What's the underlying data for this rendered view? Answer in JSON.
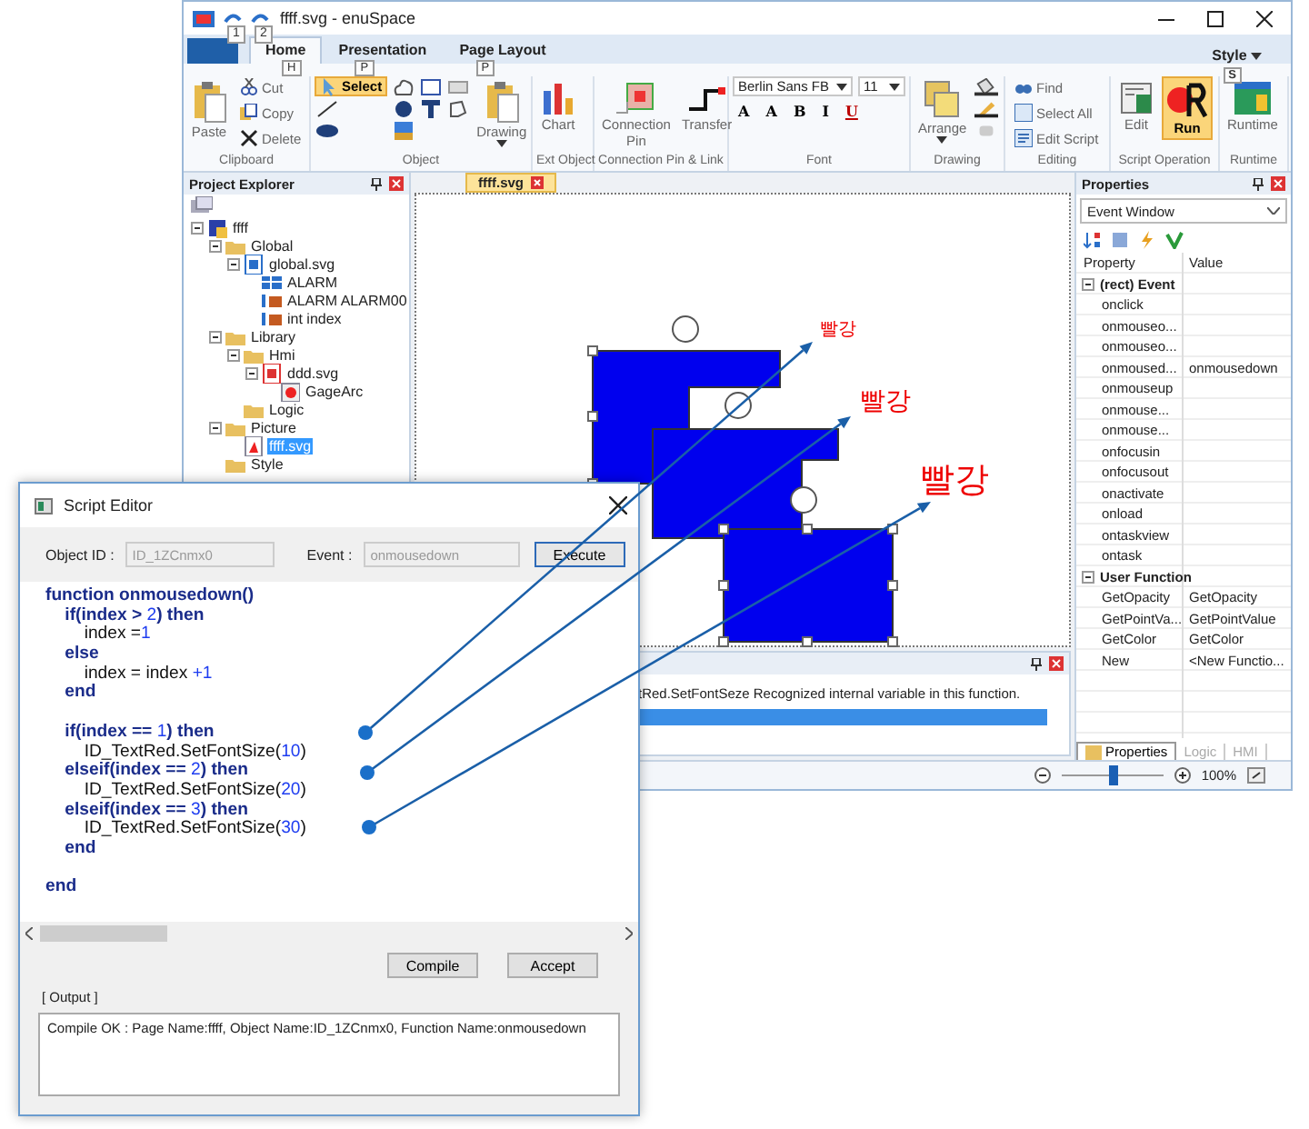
{
  "app_window": {
    "title": "ffff.svg - enuSpace",
    "quick_access_keys": [
      "1",
      "2"
    ],
    "ribbon_tabs": [
      {
        "label": "Home",
        "key": "H",
        "selected": true
      },
      {
        "label": "Presentation",
        "key": "P",
        "selected": false
      },
      {
        "label": "Page Layout",
        "key": "P",
        "selected": false
      }
    ],
    "style_menu": {
      "label": "Style",
      "key": "S"
    },
    "ribbon_groups": [
      {
        "label": "Clipboard",
        "items": [
          {
            "kind": "large",
            "label": "Paste",
            "selected": false
          },
          {
            "kind": "small",
            "label": "Cut",
            "selected": false
          },
          {
            "kind": "small",
            "label": "Copy",
            "selected": false
          },
          {
            "kind": "small",
            "label": "Delete",
            "selected": false
          }
        ]
      },
      {
        "label": "Object",
        "items": [
          {
            "kind": "small",
            "label": "Select",
            "selected": true
          },
          {
            "kind": "tool",
            "selected": false
          },
          {
            "kind": "tool",
            "selected": false
          },
          {
            "kind": "tool",
            "selected": false
          },
          {
            "kind": "tool",
            "selected": false
          },
          {
            "kind": "tool",
            "selected": false
          },
          {
            "kind": "tool",
            "selected": false
          },
          {
            "kind": "tool",
            "selected": false
          },
          {
            "kind": "tool",
            "selected": false
          },
          {
            "kind": "tool",
            "selected": false
          },
          {
            "kind": "large",
            "label": "Drawing",
            "dropdown": true,
            "selected": false
          }
        ]
      },
      {
        "label": "Ext Object",
        "items": [
          {
            "kind": "large",
            "label": "Chart",
            "selected": false
          }
        ]
      },
      {
        "label": "Connection Pin & Link",
        "items": [
          {
            "kind": "large",
            "label": "Connection Pin",
            "selected": false
          },
          {
            "kind": "large",
            "label": "Transfer",
            "selected": false
          }
        ]
      },
      {
        "label": "Font",
        "items": [
          {
            "kind": "combo",
            "value": "Berlin Sans FB"
          },
          {
            "kind": "combo",
            "value": "11"
          },
          {
            "kind": "format",
            "label": "A"
          },
          {
            "kind": "format",
            "label": "A"
          },
          {
            "kind": "format",
            "label": "B"
          },
          {
            "kind": "format",
            "label": "I"
          },
          {
            "kind": "format",
            "label": "U"
          }
        ]
      },
      {
        "label": "Drawing",
        "items": [
          {
            "kind": "large",
            "label": "Arrange",
            "dropdown": true,
            "selected": false
          },
          {
            "kind": "tool",
            "selected": false
          },
          {
            "kind": "tool",
            "selected": false
          },
          {
            "kind": "tool",
            "selected": false
          }
        ]
      },
      {
        "label": "Editing",
        "items": [
          {
            "kind": "small",
            "label": "Find",
            "selected": false
          },
          {
            "kind": "small",
            "label": "Select All",
            "selected": false
          },
          {
            "kind": "small",
            "label": "Edit Script",
            "selected": false
          }
        ]
      },
      {
        "label": "Script Operation",
        "items": [
          {
            "kind": "large",
            "label": "Edit",
            "selected": false
          },
          {
            "kind": "large",
            "label": "Run",
            "selected": true
          }
        ]
      },
      {
        "label": "Runtime",
        "items": [
          {
            "kind": "large",
            "label": "Runtime",
            "selected": false
          }
        ]
      }
    ],
    "project_explorer": {
      "title": "Project Explorer",
      "tree": [
        {
          "label": "ffff",
          "kind": "project",
          "expanded": true,
          "selected": false,
          "children": [
            {
              "label": "Global",
              "kind": "folder",
              "expanded": true,
              "selected": false,
              "children": [
                {
                  "label": "global.svg",
                  "kind": "global",
                  "expanded": true,
                  "selected": false,
                  "children": [
                    {
                      "label": "ALARM",
                      "kind": "table",
                      "selected": false
                    },
                    {
                      "label": "ALARM ALARM00",
                      "kind": "variable",
                      "selected": false
                    },
                    {
                      "label": "int index",
                      "kind": "variable",
                      "selected": false
                    }
                  ]
                }
              ]
            },
            {
              "label": "Library",
              "kind": "folder",
              "expanded": true,
              "selected": false,
              "children": [
                {
                  "label": "Hmi",
                  "kind": "folder",
                  "expanded": true,
                  "selected": false,
                  "children": [
                    {
                      "label": "ddd.svg",
                      "kind": "hmi",
                      "expanded": true,
                      "selected": false,
                      "children": [
                        {
                          "label": "GageArc",
                          "kind": "symbol",
                          "selected": false
                        }
                      ]
                    }
                  ]
                },
                {
                  "label": "Logic",
                  "kind": "folder",
                  "selected": false
                }
              ]
            },
            {
              "label": "Picture",
              "kind": "folder",
              "expanded": true,
              "selected": false,
              "children": [
                {
                  "label": "ffff.svg",
                  "kind": "page",
                  "selected": true
                }
              ]
            },
            {
              "label": "Style",
              "kind": "folder",
              "selected": false
            }
          ]
        }
      ]
    },
    "document_tabs": [
      {
        "label": "ffff.svg",
        "selected": true
      }
    ],
    "canvas": {
      "labels": [
        "빨강",
        "빨강",
        "빨강"
      ]
    },
    "output_panel": {
      "message": "tRed.SetFontSeze Recognized internal variable in this function."
    },
    "properties": {
      "title": "Properties",
      "selector": "Event Window",
      "columns": [
        "Property",
        "Value"
      ],
      "sections": [
        {
          "title": "(rect) Event",
          "expanded": true,
          "rows": [
            {
              "name": "onclick"
            },
            {
              "name": "onmouseo..."
            },
            {
              "name": "onmouseo..."
            },
            {
              "name": "onmoused...",
              "value": "onmousedown"
            },
            {
              "name": "onmouseup"
            },
            {
              "name": "onmouse..."
            },
            {
              "name": "onmouse..."
            },
            {
              "name": "onfocusin"
            },
            {
              "name": "onfocusout"
            },
            {
              "name": "onactivate"
            },
            {
              "name": "onload"
            },
            {
              "name": "ontaskview"
            },
            {
              "name": "ontask"
            }
          ]
        },
        {
          "title": "User Function",
          "expanded": true,
          "rows": [
            {
              "name": "GetOpacity",
              "value": "GetOpacity"
            },
            {
              "name": "GetPointVa...",
              "value": "GetPointValue"
            },
            {
              "name": "GetColor",
              "value": "GetColor"
            },
            {
              "name": "New",
              "value": "<New Functio..."
            }
          ]
        }
      ],
      "tabs": [
        {
          "label": "Properties",
          "selected": true
        },
        {
          "label": "Logic",
          "selected": false
        },
        {
          "label": "HMI",
          "selected": false
        }
      ]
    },
    "status_bar": {
      "zoom": "100%",
      "zoom_level": {
        "level": 0.5
      }
    }
  },
  "script_editor": {
    "title": "Script Editor",
    "object_id_label": "Object ID :",
    "object_id": "ID_1ZCnmx0",
    "event_label": "Event :",
    "event": "onmousedown",
    "execute_button": "Execute",
    "code_lines": [
      {
        "kind": "code",
        "tokens": [
          {
            "kind": "keyword",
            "text": "function onmousedown()"
          }
        ]
      },
      {
        "kind": "code",
        "tokens": [
          {
            "kind": "keyword",
            "text": "\tif(index > "
          },
          {
            "kind": "number",
            "text": "2"
          },
          {
            "kind": "keyword",
            "text": ") then"
          }
        ]
      },
      {
        "kind": "code",
        "tokens": [
          {
            "kind": "plain",
            "text": "\t\tindex ="
          },
          {
            "kind": "number",
            "text": "1"
          }
        ]
      },
      {
        "kind": "code",
        "tokens": [
          {
            "kind": "keyword",
            "text": "\telse"
          }
        ]
      },
      {
        "kind": "code",
        "tokens": [
          {
            "kind": "plain",
            "text": "\t\tindex = index "
          },
          {
            "kind": "number",
            "text": "+1"
          }
        ]
      },
      {
        "kind": "code",
        "tokens": [
          {
            "kind": "keyword",
            "text": "\tend"
          }
        ]
      },
      {
        "kind": "blank"
      },
      {
        "kind": "code",
        "tokens": [
          {
            "kind": "keyword",
            "text": "\tif(index == "
          },
          {
            "kind": "number",
            "text": "1"
          },
          {
            "kind": "keyword",
            "text": ") then"
          }
        ]
      },
      {
        "kind": "code",
        "tokens": [
          {
            "kind": "plain",
            "text": "\t\tID_TextRed.SetFontSize("
          },
          {
            "kind": "number",
            "text": "10"
          },
          {
            "kind": "plain",
            "text": ")"
          }
        ]
      },
      {
        "kind": "code",
        "tokens": [
          {
            "kind": "keyword",
            "text": "\telseif(index == "
          },
          {
            "kind": "number",
            "text": "2"
          },
          {
            "kind": "keyword",
            "text": ") then"
          }
        ]
      },
      {
        "kind": "code",
        "tokens": [
          {
            "kind": "plain",
            "text": "\t\tID_TextRed.SetFontSize("
          },
          {
            "kind": "number",
            "text": "20"
          },
          {
            "kind": "plain",
            "text": ")"
          }
        ]
      },
      {
        "kind": "code",
        "tokens": [
          {
            "kind": "keyword",
            "text": "\telseif(index == "
          },
          {
            "kind": "number",
            "text": "3"
          },
          {
            "kind": "keyword",
            "text": ") then"
          }
        ]
      },
      {
        "kind": "code",
        "tokens": [
          {
            "kind": "plain",
            "text": "\t\tID_TextRed.SetFontSize("
          },
          {
            "kind": "number",
            "text": "30"
          },
          {
            "kind": "plain",
            "text": ")"
          }
        ]
      },
      {
        "kind": "code",
        "tokens": [
          {
            "kind": "keyword",
            "text": "\tend"
          }
        ]
      },
      {
        "kind": "blank"
      },
      {
        "kind": "code",
        "tokens": [
          {
            "kind": "keyword",
            "text": "end"
          }
        ]
      }
    ],
    "buttons": [
      "Compile",
      "Accept"
    ],
    "output_label": "[ Output ]",
    "output": "Compile OK : Page Name:ffff, Object Name:ID_1ZCnmx0, Function Name:onmousedown"
  }
}
